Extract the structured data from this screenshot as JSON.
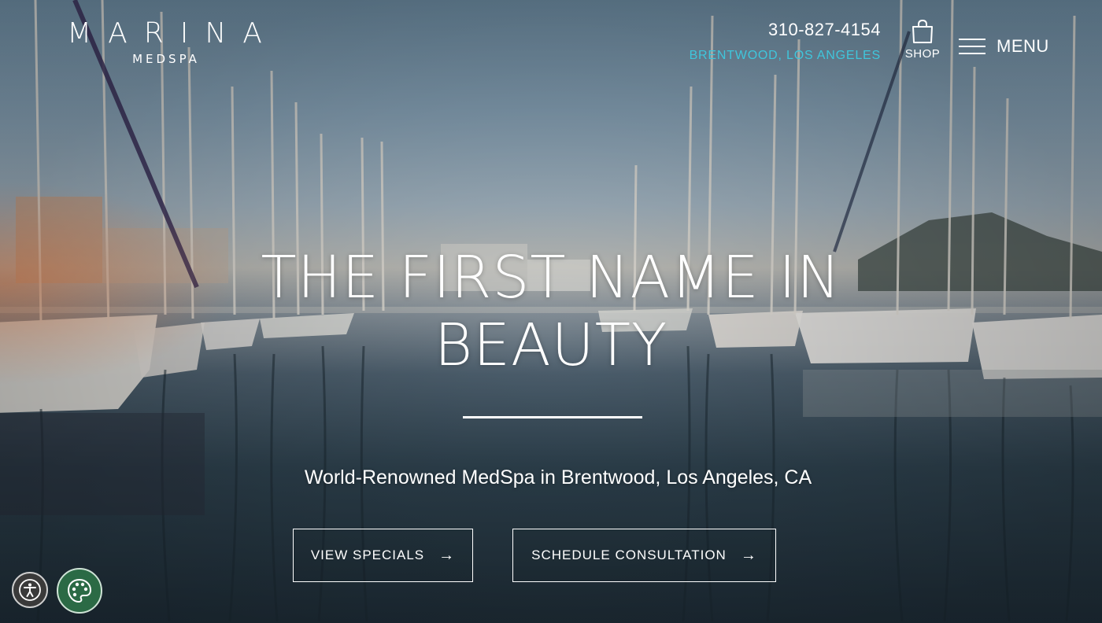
{
  "brand": {
    "name": "MARINA",
    "tagline": "MEDSPA"
  },
  "header": {
    "phone": "310-827-4154",
    "location": "BRENTWOOD, LOS ANGELES",
    "shop_label": "SHOP",
    "menu_label": "MENU"
  },
  "hero": {
    "headline_line1": "THE FIRST NAME IN",
    "headline_line2": "BEAUTY",
    "subtitle": "World-Renowned MedSpa in Brentwood, Los Angeles, CA",
    "buttons": [
      {
        "label": "VIEW SPECIALS",
        "icon": "arrow-right-icon"
      },
      {
        "label": "SCHEDULE CONSULTATION",
        "icon": "arrow-right-icon"
      }
    ],
    "background": "marina-sailboats-photo"
  },
  "widgets": {
    "accessibility_icon": "accessibility-icon",
    "palette_icon": "palette-icon"
  },
  "colors": {
    "accent": "#3fc6dc",
    "text": "#ffffff",
    "palette_button": "#2b6a45"
  }
}
